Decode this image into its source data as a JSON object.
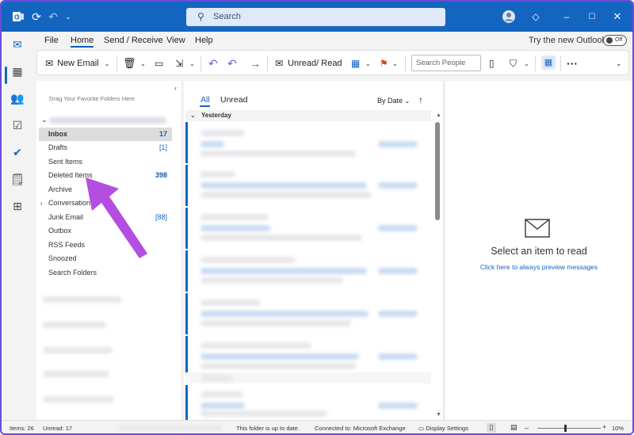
{
  "titlebar": {
    "search_label": "Search"
  },
  "menu": {
    "items": [
      "File",
      "Home",
      "Send / Receive",
      "View",
      "Help"
    ],
    "try_new": "Try the new Outlook",
    "toggle_label": "Off"
  },
  "ribbon": {
    "new_email": "New Email",
    "unread_read": "Unread/ Read",
    "search_people_placeholder": "Search People"
  },
  "folder_pane": {
    "hint": "Drag Your Favorite Folders Here",
    "folders": [
      {
        "label": "Inbox",
        "count": "17",
        "selected": true
      },
      {
        "label": "Drafts",
        "count": "[1]"
      },
      {
        "label": "Sent Items",
        "count": ""
      },
      {
        "label": "Deleted Items",
        "count": "398"
      },
      {
        "label": "Archive",
        "count": ""
      },
      {
        "label": "Conversation",
        "count": ""
      },
      {
        "label": "Junk Email",
        "count": "[88]"
      },
      {
        "label": "Outbox",
        "count": ""
      },
      {
        "label": "RSS Feeds",
        "count": ""
      },
      {
        "label": "Snoozed",
        "count": ""
      },
      {
        "label": "Search Folders",
        "count": ""
      }
    ]
  },
  "message_list": {
    "tab_all": "All",
    "tab_unread": "Unread",
    "sort": "By Date",
    "group_yesterday": "Yesterday"
  },
  "reading_pane": {
    "title": "Select an item to read",
    "link": "Click here to always preview messages"
  },
  "statusbar": {
    "items": "Items: 26",
    "unread": "Unread: 17",
    "uptodate": "This folder is up to date.",
    "connected": "Connected to: Microsoft Exchange",
    "display_settings": "Display Settings",
    "zoom": "10%"
  },
  "colors": {
    "brand": "#1465c0",
    "annotation_arrow": "#b44ee0"
  }
}
